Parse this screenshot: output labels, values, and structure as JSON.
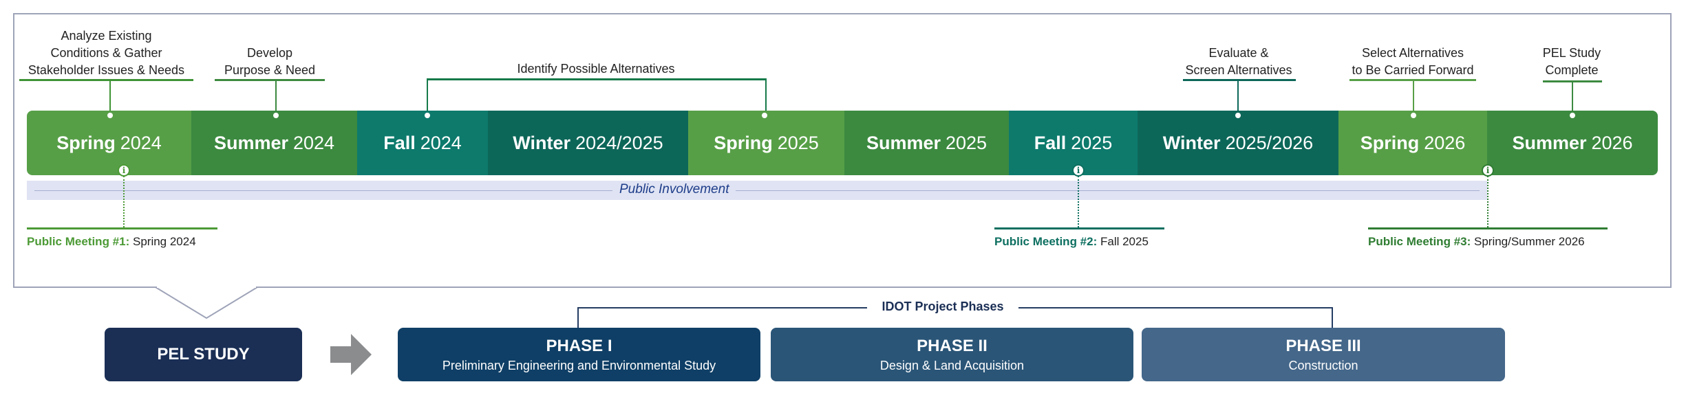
{
  "seasons": [
    {
      "name": "Spring",
      "year": "2024",
      "color": "#579f47"
    },
    {
      "name": "Summer",
      "year": "2024",
      "color": "#3c8a40"
    },
    {
      "name": "Fall",
      "year": "2024",
      "color": "#0d7a6c"
    },
    {
      "name": "Winter",
      "year": "2024/2025",
      "color": "#0d6759"
    },
    {
      "name": "Spring",
      "year": "2025",
      "color": "#579f47"
    },
    {
      "name": "Summer",
      "year": "2025",
      "color": "#3c8a40"
    },
    {
      "name": "Fall",
      "year": "2025",
      "color": "#0d7a6c"
    },
    {
      "name": "Winter",
      "year": "2025/2026",
      "color": "#0d6759"
    },
    {
      "name": "Spring",
      "year": "2026",
      "color": "#579f47"
    },
    {
      "name": "Summer",
      "year": "2026",
      "color": "#3c8a40"
    }
  ],
  "milestones": {
    "m1": [
      "Analyze Existing",
      "Conditions & Gather",
      "Stakeholder Issues & Needs"
    ],
    "m2": [
      "Develop",
      "Purpose & Need"
    ],
    "m3": "Identify Possible Alternatives",
    "m4": [
      "Evaluate &",
      "Screen Alternatives"
    ],
    "m5": [
      "Select Alternatives",
      "to Be Carried Forward"
    ],
    "m6": [
      "PEL Study",
      "Complete"
    ]
  },
  "public_involvement": "Public Involvement",
  "meetings": [
    {
      "label": "Public Meeting #1:",
      "when": "Spring 2024",
      "color": "#4c9a35"
    },
    {
      "label": "Public Meeting #2:",
      "when": "Fall 2025",
      "color": "#0d6f60"
    },
    {
      "label": "Public Meeting #3:",
      "when": "Spring/Summer 2026",
      "color": "#2f7d32"
    }
  ],
  "info_glyph": "i",
  "pel_study": "PEL STUDY",
  "phases_title": "IDOT Project Phases",
  "phases": [
    {
      "title": "PHASE I",
      "subtitle": "Preliminary Engineering and Environmental Study"
    },
    {
      "title": "PHASE II",
      "subtitle": "Design & Land Acquisition"
    },
    {
      "title": "PHASE III",
      "subtitle": "Construction"
    }
  ]
}
